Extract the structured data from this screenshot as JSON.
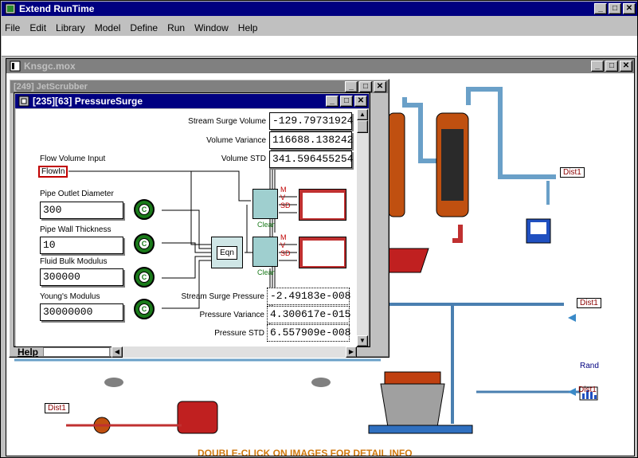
{
  "app": {
    "title": "Extend RunTime",
    "menu": [
      "File",
      "Edit",
      "Library",
      "Model",
      "Define",
      "Run",
      "Window",
      "Help"
    ]
  },
  "model_window": {
    "title": "Knsgc.mox",
    "dist_labels": [
      "Dist1",
      "Dist1",
      "Dist1",
      "Dist1",
      "Dist1"
    ],
    "rand_label": "Rand",
    "footer_note": "DOUBLE-CLICK ON IMAGES FOR DETAIL INFO"
  },
  "jet_window": {
    "title": "[249]    JetScrubber"
  },
  "surge_window": {
    "title": "[235][63]   PressureSurge",
    "stream_surge_volume_label": "Stream Surge Volume",
    "stream_surge_volume_value": "-129.79731924",
    "volume_variance_label": "Volume Variance",
    "volume_variance_value": "116688.138242",
    "volume_std_label": "Volume STD",
    "volume_std_value": "341.596455254",
    "flow_volume_input_label": "Flow Volume Input",
    "flow_in_label": "FlowIn",
    "pipe_outlet_diameter_label": "Pipe Outlet Diameter",
    "pipe_outlet_diameter_value": "300",
    "pipe_wall_thickness_label": "Pipe Wall Thickness",
    "pipe_wall_thickness_value": "10",
    "fluid_bulk_modulus_label": "Fluid Bulk Modulus",
    "fluid_bulk_modulus_value": "300000",
    "youngs_modulus_label": "Young's Modulus",
    "youngs_modulus_value": "30000000",
    "stream_surge_pressure_label": "Stream Surge Pressure",
    "stream_surge_pressure_value": "-2.49183e-008",
    "pressure_variance_label": "Pressure Variance",
    "pressure_variance_value": "4.300617e-015",
    "pressure_std_label": "Pressure STD",
    "pressure_std_value": "6.557909e-008",
    "eqn_label": "Eqn",
    "const_label": "C",
    "clear_label": "Clear",
    "stat_m": "M",
    "stat_v": "V",
    "stat_sd": "SD",
    "help_label": "Help"
  }
}
